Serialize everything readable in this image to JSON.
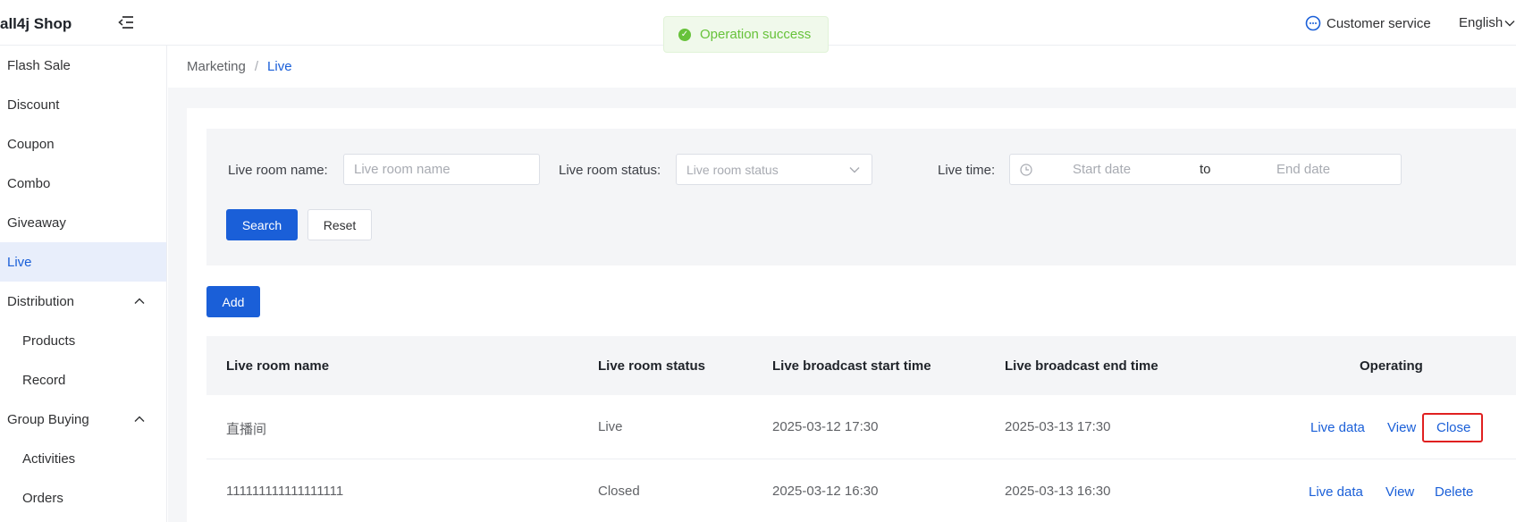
{
  "header": {
    "logo": "all4j Shop",
    "toast": "Operation success",
    "customer_service": "Customer service",
    "language": "English"
  },
  "sidebar": {
    "items": [
      {
        "label": "Flash Sale"
      },
      {
        "label": "Discount"
      },
      {
        "label": "Coupon"
      },
      {
        "label": "Combo"
      },
      {
        "label": "Giveaway"
      },
      {
        "label": "Live"
      },
      {
        "label": "Distribution"
      },
      {
        "label": "Products"
      },
      {
        "label": "Record"
      },
      {
        "label": "Group Buying"
      },
      {
        "label": "Activities"
      },
      {
        "label": "Orders"
      }
    ]
  },
  "breadcrumb": {
    "parent": "Marketing",
    "separator": "/",
    "current": "Live"
  },
  "filter": {
    "room_name_label": "Live room name:",
    "room_name_placeholder": "Live room name",
    "room_status_label": "Live room status:",
    "room_status_placeholder": "Live room status",
    "live_time_label": "Live time:",
    "start_placeholder": "Start date",
    "range_sep": "to",
    "end_placeholder": "End date",
    "search_button": "Search",
    "reset_button": "Reset"
  },
  "add_button": "Add",
  "table": {
    "columns": [
      "Live room name",
      "Live room status",
      "Live broadcast start time",
      "Live broadcast end time",
      "Operating"
    ],
    "rows": [
      {
        "name": "直播间",
        "status": "Live",
        "start": "2025-03-12 17:30",
        "end": "2025-03-13 17:30",
        "ops": [
          "Live data",
          "View",
          "Close"
        ]
      },
      {
        "name": "111111111111111111",
        "status": "Closed",
        "start": "2025-03-12 16:30",
        "end": "2025-03-13 16:30",
        "ops": [
          "Live data",
          "View",
          "Delete"
        ]
      }
    ]
  },
  "colors": {
    "primary": "#1a5fd8",
    "success": "#67c23a",
    "highlight": "#e02020"
  }
}
